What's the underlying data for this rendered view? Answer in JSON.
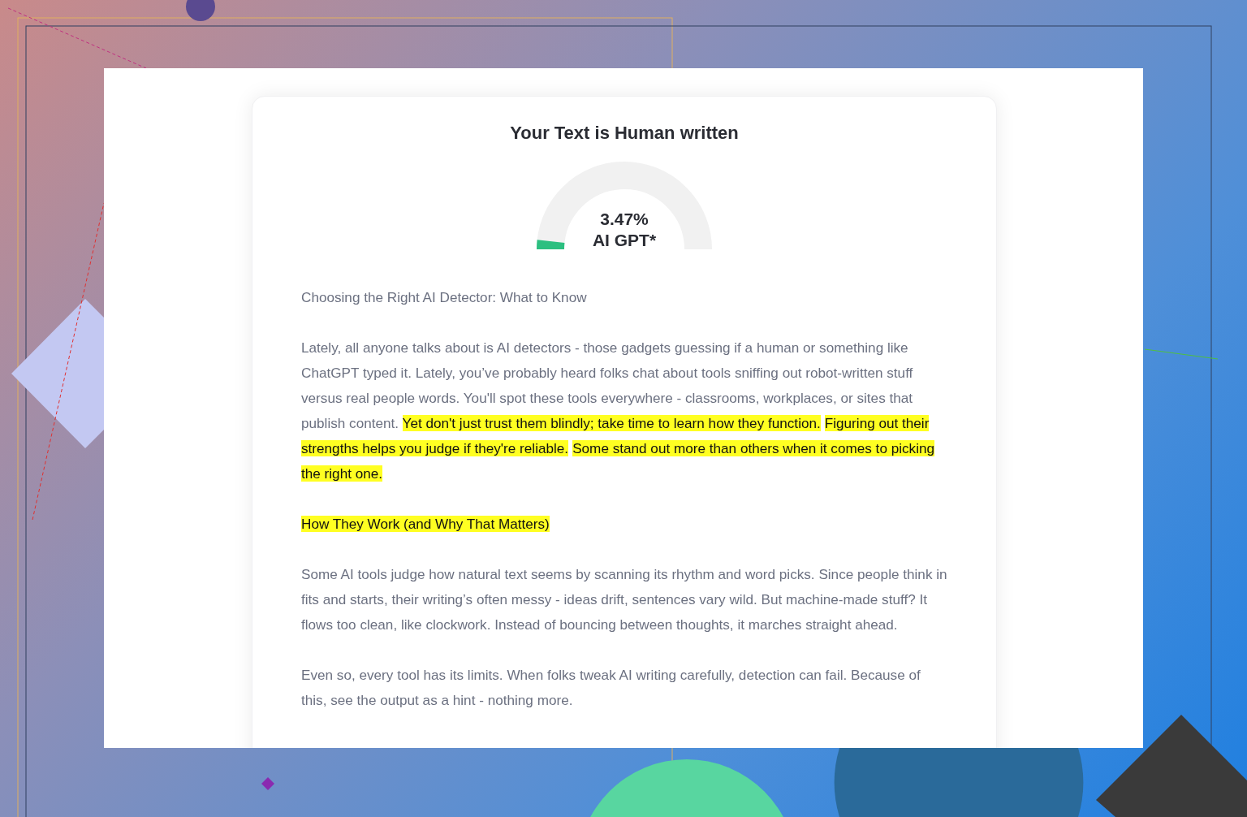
{
  "result": {
    "title": "Your Text is Human written",
    "gauge": {
      "level": 0.0347,
      "percent": "3.47%",
      "label": "AI GPT*"
    }
  },
  "paragraphs": [
    {
      "segments": [
        {
          "text": "Choosing the Right AI Detector: What to Know",
          "highlighted": false
        }
      ]
    },
    {
      "segments": [
        {
          "text": "Lately, all anyone talks about is AI detectors - those gadgets guessing if a human or something like ChatGPT typed it. Lately, you’ve probably heard folks chat about tools sniffing out robot-written stuff versus real people words. You'll spot these tools everywhere - classrooms, workplaces, or sites that publish content. ",
          "highlighted": false
        },
        {
          "text": "Yet don't just trust them blindly; take time to learn how they function.",
          "highlighted": true
        },
        {
          "text": "Figuring out their strengths helps you judge if they're reliable.",
          "highlighted": true
        },
        {
          "text": "Some stand out more than others when it comes to picking the right one.",
          "highlighted": true
        }
      ]
    },
    {
      "segments": [
        {
          "text": "How They Work (and Why That Matters)",
          "highlighted": true
        }
      ]
    },
    {
      "segments": [
        {
          "text": "Some AI tools judge how natural text seems by scanning its rhythm and word picks. Since people think in fits and starts, their writing’s often messy - ideas drift, sentences vary wild. But machine-made stuff? It flows too clean, like clockwork. Instead of bouncing between thoughts, it marches straight ahead.",
          "highlighted": false
        }
      ]
    },
    {
      "segments": [
        {
          "text": "Even so, every tool has its limits. When folks tweak AI writing carefully, detection can fail. Because of this, see the output as a hint - nothing more.",
          "highlighted": false
        }
      ]
    }
  ]
}
